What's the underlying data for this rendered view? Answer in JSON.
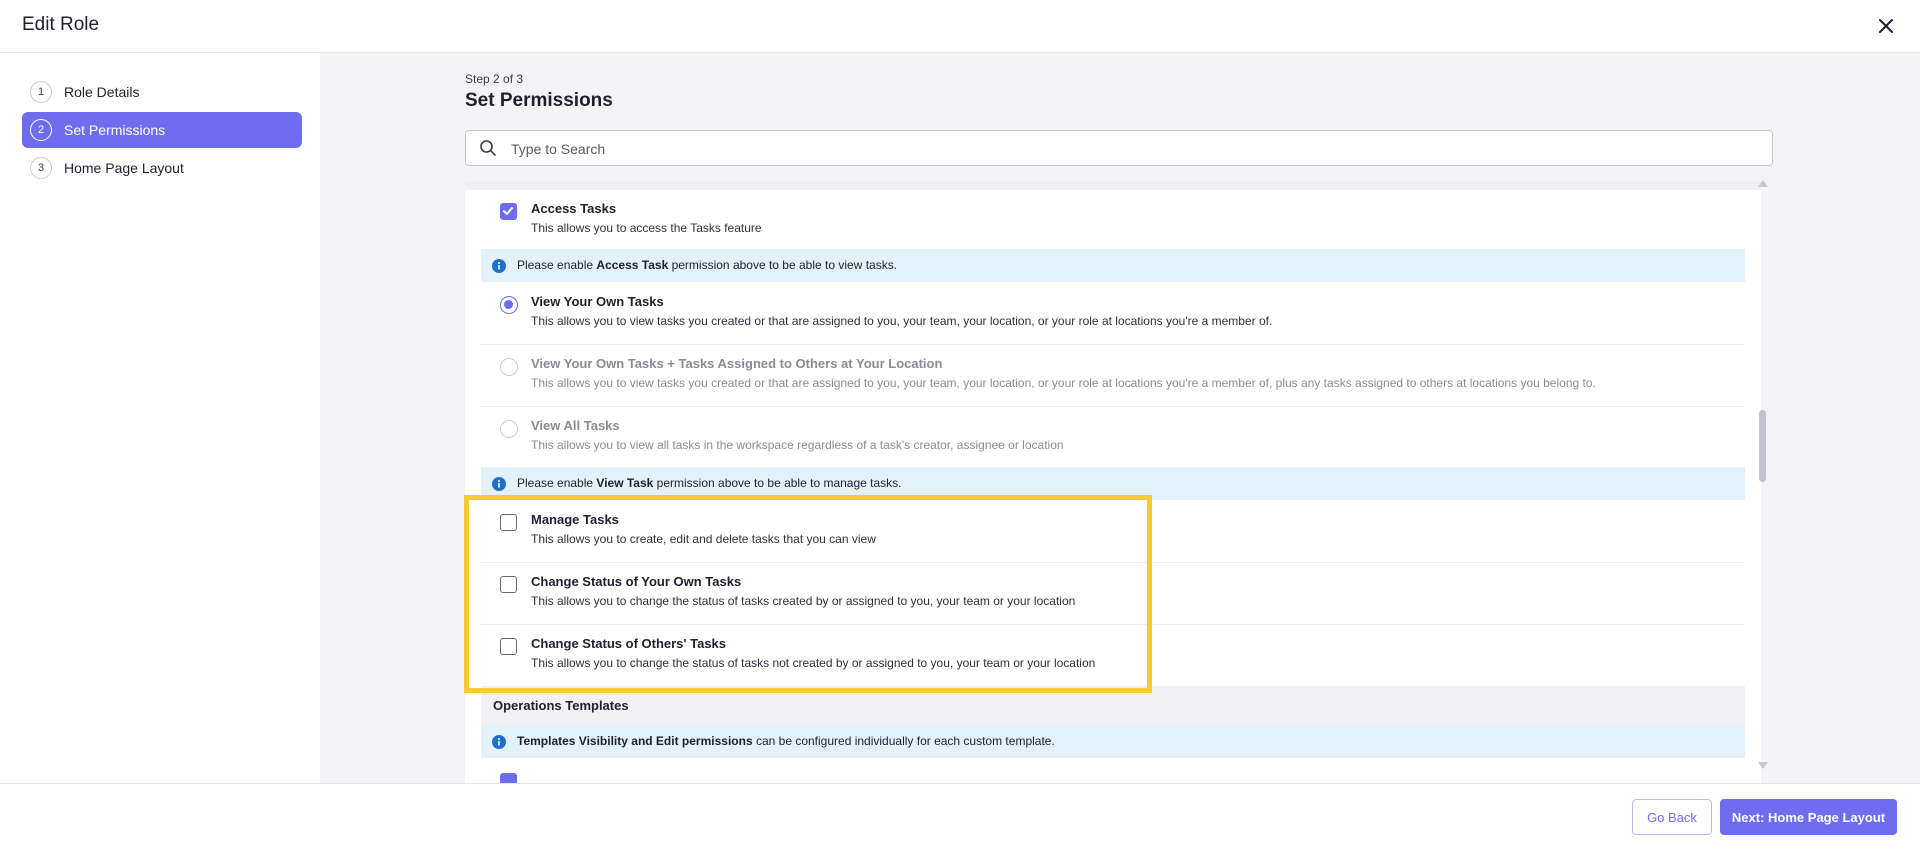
{
  "header": {
    "title": "Edit Role"
  },
  "sidebar": {
    "steps": [
      {
        "num": "1",
        "label": "Role Details"
      },
      {
        "num": "2",
        "label": "Set Permissions"
      },
      {
        "num": "3",
        "label": "Home Page Layout"
      }
    ],
    "active_step": 2
  },
  "main": {
    "step_caption": "Step 2 of 3",
    "title": "Set Permissions",
    "search": {
      "placeholder": "Type to Search",
      "value": ""
    }
  },
  "permissions": {
    "access_tasks": {
      "title": "Access Tasks",
      "desc": "This allows you to access the Tasks feature",
      "checked": true
    },
    "info_access": {
      "pre": "Please enable ",
      "bold": "Access Task",
      "post": " permission above to be able to view tasks."
    },
    "view_own": {
      "title": "View Your Own Tasks",
      "desc": "This allows you to view tasks you created or that are assigned to you, your team, your location, or your role at locations you're a member of.",
      "selected": true
    },
    "view_own_location": {
      "title": "View Your Own Tasks + Tasks Assigned to Others at Your Location",
      "desc": "This allows you to view tasks you created or that are assigned to you, your team, your location, or your role at locations you're a member of, plus any tasks assigned to others at locations you belong to.",
      "selected": false
    },
    "view_all": {
      "title": "View All Tasks",
      "desc": "This allows you to view all tasks in the workspace regardless of a task's creator, assignee or location",
      "selected": false
    },
    "info_view": {
      "pre": "Please enable ",
      "bold": "View Task",
      "post": " permission above to be able to manage tasks."
    },
    "manage_tasks": {
      "title": "Manage Tasks",
      "desc": "This allows you to create, edit and delete tasks that you can view",
      "checked": false
    },
    "change_status_own": {
      "title": "Change Status of Your Own Tasks",
      "desc": "This allows you to change the status of tasks created by or assigned to you, your team or your location",
      "checked": false
    },
    "change_status_others": {
      "title": "Change Status of Others' Tasks",
      "desc": "This allows you to change the status of tasks not created by or assigned to you, your team or your location",
      "checked": false
    },
    "section_templates": {
      "title": "Operations Templates"
    },
    "info_templates": {
      "bold": "Templates Visibility and Edit permissions",
      "post": " can be configured individually for each custom template."
    }
  },
  "footer": {
    "back_label": "Go Back",
    "next_label": "Next: Home Page Layout"
  },
  "colors": {
    "accent": "#6d6df0",
    "info_bg": "#e3f1fb",
    "highlight": "#f7c934",
    "info_icon": "#1f6fd1"
  }
}
